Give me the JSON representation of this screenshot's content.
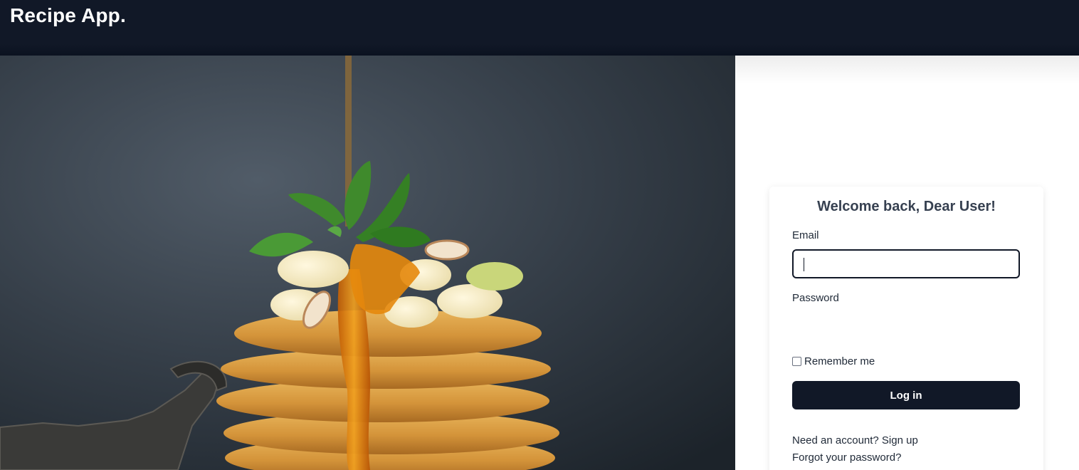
{
  "navbar": {
    "brand": "Recipe App."
  },
  "hero": {
    "image_subject": "pancake-stack-photo"
  },
  "login": {
    "title": "Welcome back, Dear User!",
    "email_label": "Email",
    "email_value": "",
    "password_label": "Password",
    "remember_label": "Remember me",
    "remember_checked": false,
    "submit_label": "Log in",
    "signup_link": "Need an account? Sign up",
    "forgot_link": "Forgot your password?"
  },
  "colors": {
    "navbar": "#111827",
    "button": "#111827",
    "heading": "#374151"
  }
}
